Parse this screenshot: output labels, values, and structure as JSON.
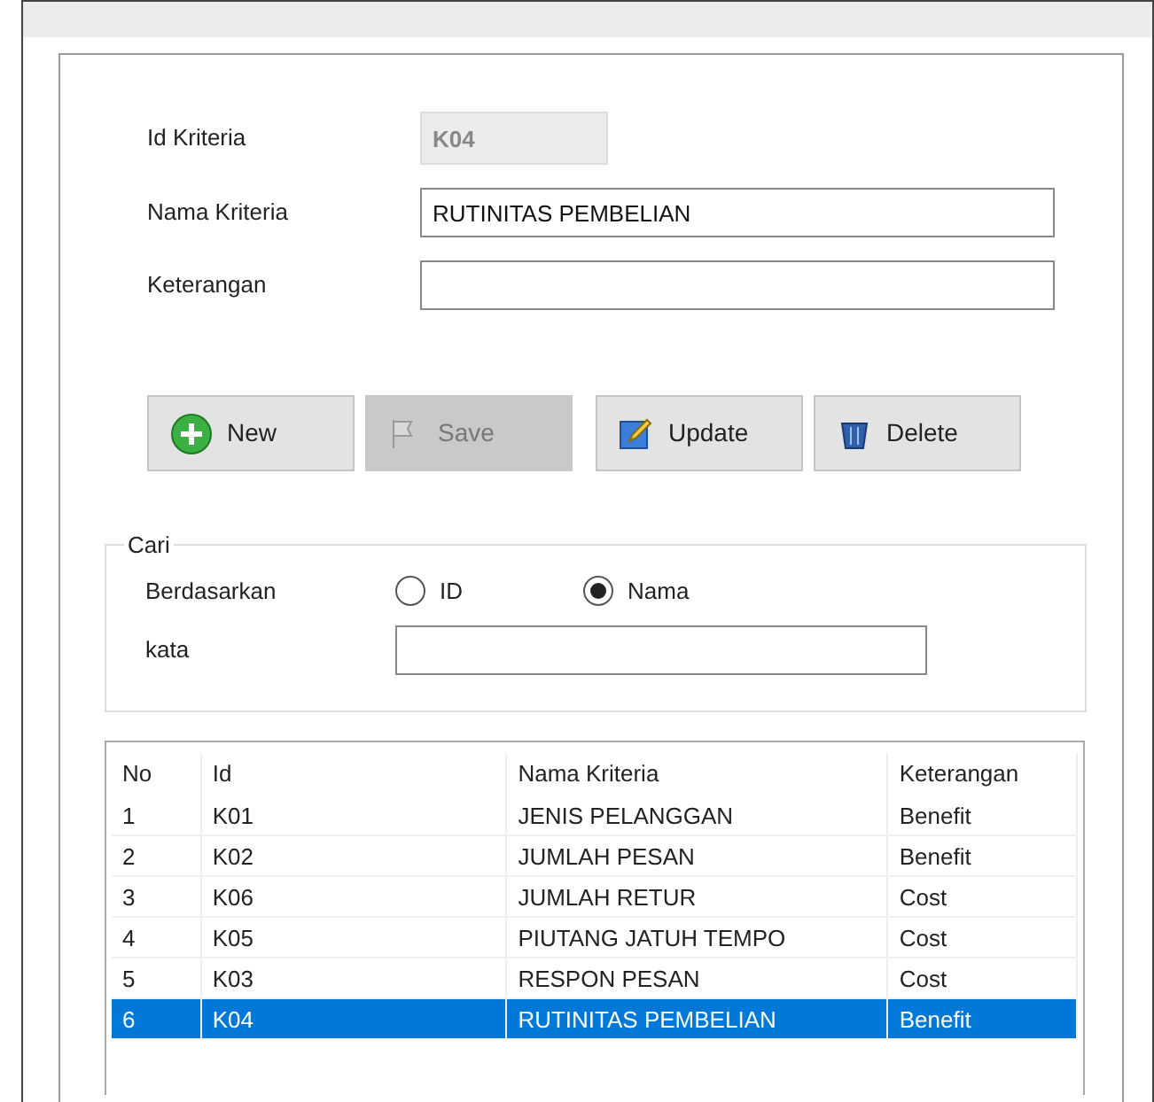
{
  "form": {
    "fields": [
      {
        "label": "Id Kriteria",
        "value": "K04",
        "disabled": true
      },
      {
        "label": "Nama  Kriteria",
        "value": "RUTINITAS PEMBELIAN",
        "disabled": false
      },
      {
        "label": "Keterangan",
        "disabled": false
      }
    ]
  },
  "buttons": [
    {
      "label": "New",
      "kind": "new",
      "disabled": false
    },
    {
      "label": "Save",
      "kind": "save",
      "disabled": true
    },
    {
      "label": "Update",
      "kind": "update",
      "disabled": false
    },
    {
      "label": "Delete",
      "kind": "delete",
      "disabled": false
    }
  ],
  "search": {
    "title": "Cari",
    "by_label": "Berdasarkan",
    "options": [
      {
        "label": "ID",
        "selected": false
      },
      {
        "label": "Nama",
        "selected": true
      }
    ],
    "word_label": "kata"
  },
  "table": {
    "columns": [
      "No",
      "Id",
      "Nama Kriteria",
      "Keterangan"
    ],
    "rows": [
      {
        "cells": [
          "1",
          "K01",
          "JENIS PELANGGAN",
          "Benefit"
        ],
        "selected": false
      },
      {
        "cells": [
          "2",
          "K02",
          "JUMLAH PESAN",
          "Benefit"
        ],
        "selected": false
      },
      {
        "cells": [
          "3",
          "K06",
          "JUMLAH RETUR",
          "Cost"
        ],
        "selected": false
      },
      {
        "cells": [
          "4",
          "K05",
          "PIUTANG JATUH TEMPO",
          "Cost"
        ],
        "selected": false
      },
      {
        "cells": [
          "5",
          "K03",
          "RESPON PESAN",
          "Cost"
        ],
        "selected": false
      },
      {
        "cells": [
          "6",
          "K04",
          "RUTINITAS PEMBELIAN",
          "Benefit"
        ],
        "selected": true
      }
    ]
  }
}
